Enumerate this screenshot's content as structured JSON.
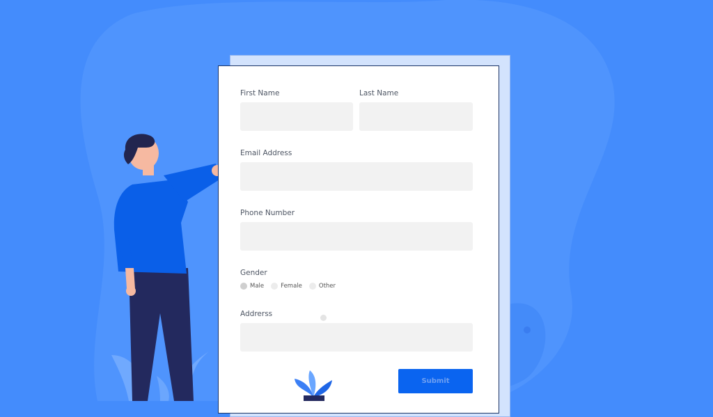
{
  "form": {
    "first_name": {
      "label": "First Name",
      "value": ""
    },
    "last_name": {
      "label": "Last Name",
      "value": ""
    },
    "email": {
      "label": "Email Address",
      "value": ""
    },
    "phone": {
      "label": "Phone Number",
      "value": ""
    },
    "gender": {
      "label": "Gender",
      "options": [
        "Male",
        "Female",
        "Other"
      ],
      "selected": "Male"
    },
    "address": {
      "label": "Addrerss",
      "value": ""
    },
    "submit_label": "Submit"
  },
  "colors": {
    "background": "#448cfc",
    "accent": "#0a64f0",
    "person_shirt": "#0a5fe8",
    "person_pants": "#23295e",
    "field_bg": "#f2f2f2"
  },
  "icons": [
    "male-person-illustration",
    "plant-illustration",
    "leaves-illustration"
  ]
}
